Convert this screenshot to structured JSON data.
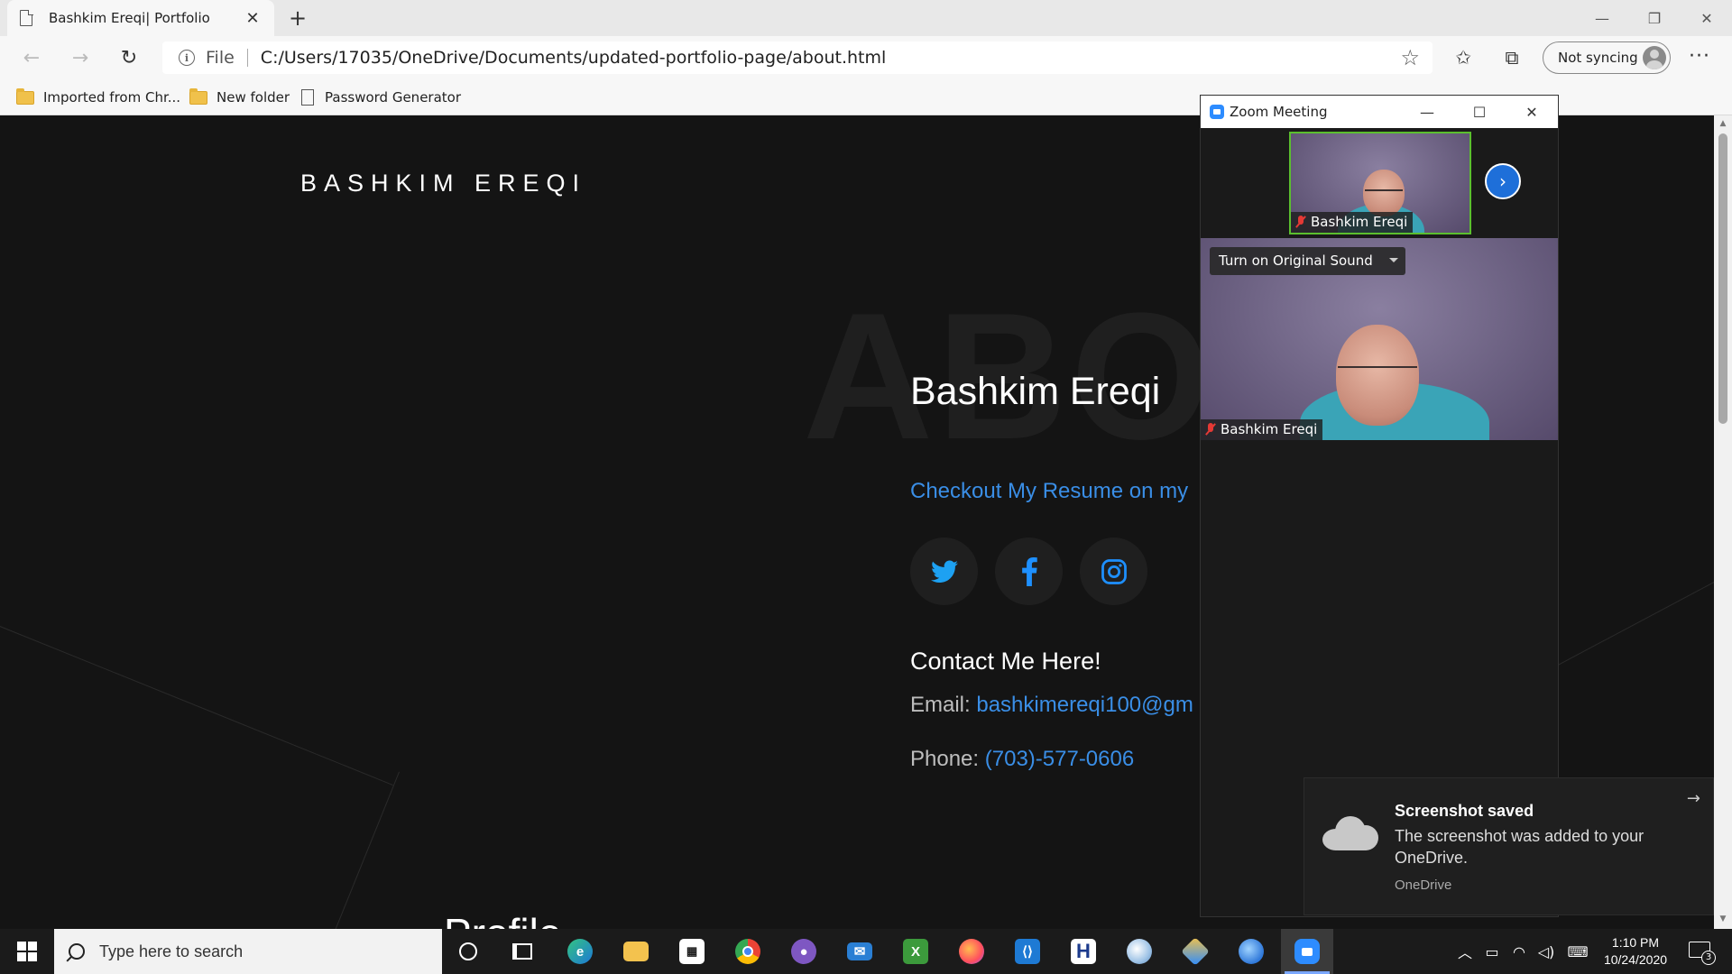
{
  "browser": {
    "tab_title": "Bashkim Ereqi| Portfolio",
    "new_tab_label": "+",
    "file_label": "File",
    "url": "C:/Users/17035/OneDrive/Documents/updated-portfolio-page/about.html",
    "sync_label": "Not syncing",
    "bookmarks": [
      {
        "label": "Imported from Chr...",
        "icon": "folder-icon"
      },
      {
        "label": "New folder",
        "icon": "folder-icon"
      },
      {
        "label": "Password Generator",
        "icon": "page-icon"
      }
    ]
  },
  "page": {
    "logo": "BASHKIM EREQI",
    "background_word": "ABO",
    "name": "Bashkim Ereqi",
    "resume_link": "Checkout My Resume on my",
    "social": [
      "twitter-icon",
      "facebook-icon",
      "instagram-icon"
    ],
    "contact_title": "Contact Me Here!",
    "email_label": "Email:",
    "email_value": "bashkimereqi100@gm",
    "phone_label": "Phone:",
    "phone_value": "(703)-577-0606",
    "profile_heading": "Profile"
  },
  "zoom": {
    "title": "Zoom Meeting",
    "small_participant": "Bashkim Ereqi",
    "main_participant": "Bashkim Ereqi",
    "original_sound_label": "Turn on Original Sound"
  },
  "toast": {
    "title": "Screenshot saved",
    "body": "The screenshot was added to your OneDrive.",
    "source": "OneDrive"
  },
  "taskbar": {
    "search_placeholder": "Type here to search",
    "time": "1:10 PM",
    "date": "10/24/2020",
    "notification_count": "3"
  },
  "colors": {
    "accent_link": "#3a8ee6",
    "page_bg": "#141414",
    "zoom_blue": "#2d8cff"
  }
}
